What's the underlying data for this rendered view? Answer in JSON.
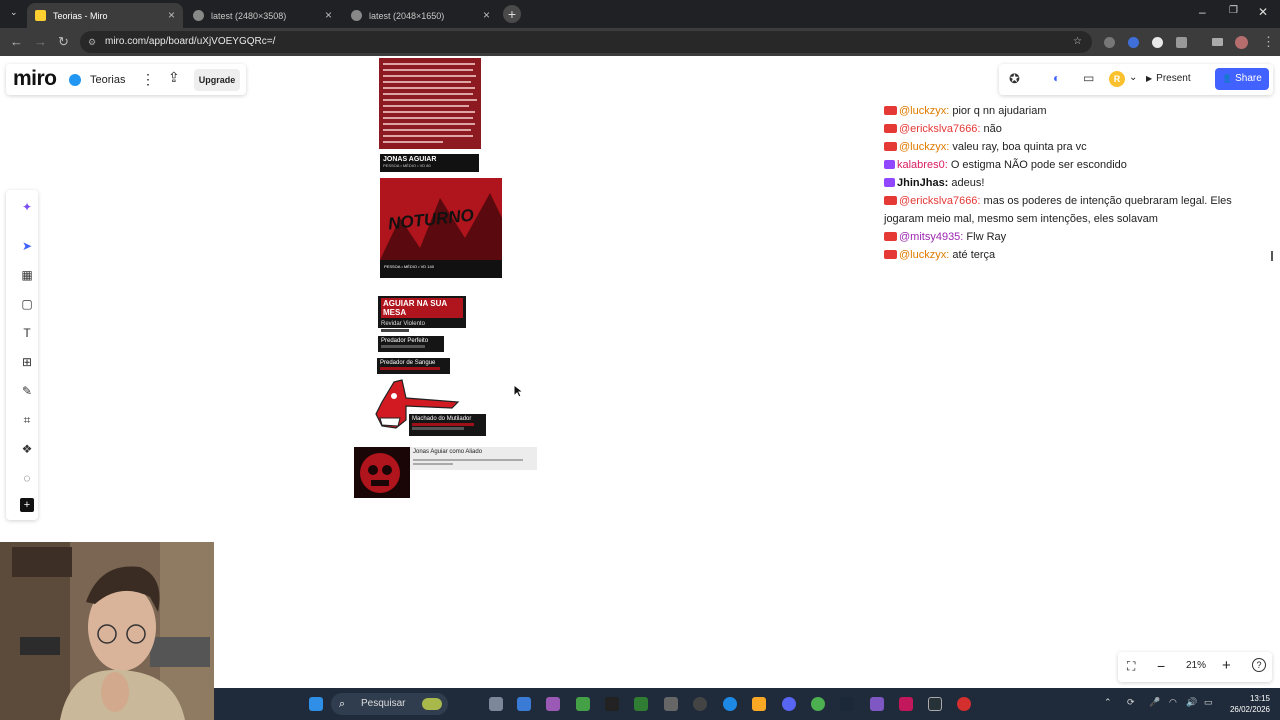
{
  "browser": {
    "tabs": [
      {
        "label": "Teorias - Miro",
        "active": true
      },
      {
        "label": "latest (2480×3508)",
        "active": false
      },
      {
        "label": "latest (2048×1650)",
        "active": false
      }
    ],
    "url": "miro.com/app/board/uXjVOEYGQRc=/"
  },
  "miro": {
    "logo": "miro",
    "board_name": "Teorias",
    "upgrade_label": "Upgrade",
    "present_label": "Present",
    "share_label": "Share",
    "avatar_initial": "R",
    "zoom": "21%"
  },
  "cards": {
    "jonas_name": "JONAS AGUIAR",
    "jonas_sub": "PESSOA • MÉDIO • VD 80",
    "poster_title": "NOTURNO",
    "poster_sub": "PESSOA • MÉDIO • VD 140",
    "mesa_title": "AGUIAR NA SUA MESA",
    "mesa_sub": "Revidar Violento",
    "pred1": "Predador Perfeito",
    "pred2": "Predador de Sangue",
    "machado": "Machado do Mutilador",
    "aliado_title": "Jonas Aguiar como Aliado"
  },
  "chat": [
    {
      "icon": "youtube",
      "user": "@luckzyx:",
      "color": "orange",
      "msg": " pior q nn ajudariam"
    },
    {
      "icon": "youtube",
      "user": "@erickslva7666:",
      "color": "red",
      "msg": " não"
    },
    {
      "icon": "youtube",
      "user": "@luckzyx:",
      "color": "orange",
      "msg": " valeu ray, boa quinta pra vc"
    },
    {
      "icon": "twitch",
      "user": "kalabres0:",
      "color": "pink",
      "msg": " O estigma NÃO pode ser escondido"
    },
    {
      "icon": "twitch",
      "user": "JhinJhas:",
      "color": "black",
      "msg": " adeus!"
    },
    {
      "icon": "youtube",
      "user": "@erickslva7666:",
      "color": "red",
      "msg": " mas os poderes de intenção quebraram legal. Eles jogaram meio mal, mesmo sem intenções, eles solavam"
    },
    {
      "icon": "youtube",
      "user": "@mitsy4935:",
      "color": "purple",
      "msg": " Flw Ray"
    },
    {
      "icon": "youtube",
      "user": "@luckzyx:",
      "color": "orange",
      "msg": " até terça"
    }
  ],
  "taskbar": {
    "search_label": "Pesquisar",
    "time": "13:15",
    "date": "26/02/2026"
  }
}
